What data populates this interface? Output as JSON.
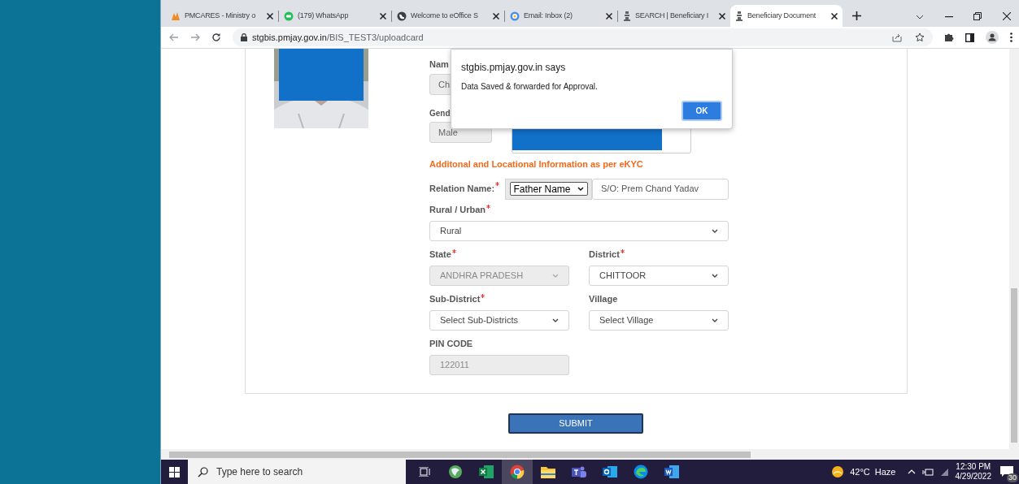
{
  "browser": {
    "tabs": [
      {
        "title": "PMCARES - Ministry o",
        "selected": false
      },
      {
        "title": "(179) WhatsApp",
        "selected": false
      },
      {
        "title": "Welcome to eOffice S",
        "selected": false
      },
      {
        "title": "Email: Inbox (2)",
        "selected": false
      },
      {
        "title": "SEARCH | Beneficiary I",
        "selected": false
      },
      {
        "title": "Beneficiary Document",
        "selected": true
      }
    ],
    "url_host": "stgbis.pmjay.gov.in",
    "url_path": "/BIS_TEST3/uploadcard"
  },
  "dialog": {
    "origin": "stgbis.pmjay.gov.in says",
    "message": "Data Saved & forwarded for Approval.",
    "button": "OK"
  },
  "form": {
    "name_label": "Nam",
    "name_value": "Ch",
    "gender_label": "Gend",
    "gender_value": "Male",
    "section_heading": "Additonal and Locational Information as per eKYC",
    "relation": {
      "label": "Relation Name:",
      "required": true,
      "type_value": "Father Name",
      "value": "S/O: Prem Chand Yadav"
    },
    "rows": [
      [
        {
          "label": "Rural / Urban",
          "required": true,
          "value": "Rural",
          "kind": "select",
          "disabled": false
        }
      ],
      [
        {
          "label": "State",
          "required": true,
          "value": "ANDHRA PRADESH",
          "kind": "select",
          "disabled": true
        },
        {
          "label": "District",
          "required": true,
          "value": "CHITTOOR",
          "kind": "select",
          "disabled": false
        }
      ],
      [
        {
          "label": "Sub-District",
          "required": true,
          "value": "Select Sub-Districts",
          "kind": "select",
          "disabled": false
        },
        {
          "label": "Village",
          "required": false,
          "value": "Select Village",
          "kind": "select",
          "disabled": false
        }
      ],
      [
        {
          "label": "PIN CODE",
          "required": false,
          "value": "122011",
          "kind": "input",
          "disabled": true
        }
      ]
    ],
    "submit": "SUBMIT"
  },
  "taskbar": {
    "search_placeholder": "Type here to search",
    "apps": [
      {
        "selected": false
      },
      {
        "selected": false
      },
      {
        "selected": false
      },
      {
        "selected": true
      },
      {
        "selected": false
      },
      {
        "selected": false
      },
      {
        "selected": false
      },
      {
        "selected": false
      },
      {
        "selected": false
      }
    ],
    "temperature": "42°C",
    "weather": "Haze",
    "time": "12:30 PM",
    "date": "4/29/2022",
    "notification_count": "30"
  }
}
